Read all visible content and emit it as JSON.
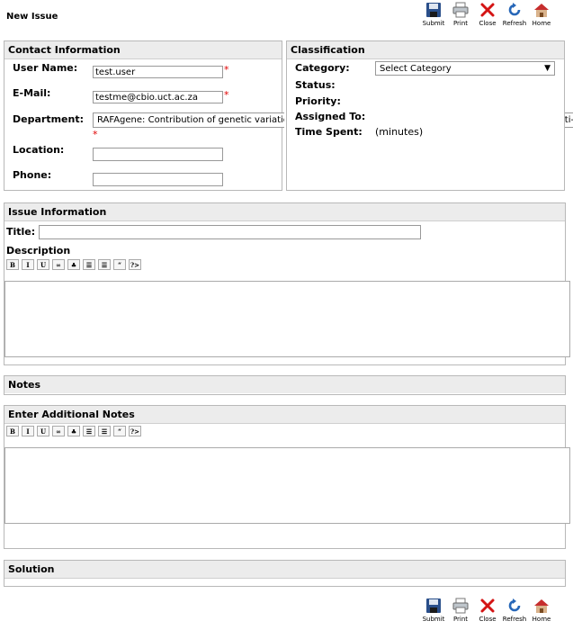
{
  "page": {
    "title": "New Issue"
  },
  "toolbar": {
    "submit": "Submit",
    "print": "Print",
    "close": "Close",
    "refresh": "Refresh",
    "home": "Home"
  },
  "contact": {
    "heading": "Contact Information",
    "user_name_label": "User Name:",
    "user_name_value": "test.user",
    "email_label": "E-Mail:",
    "email_value": "testme@cbio.uct.ac.za",
    "department_label": "Department:",
    "department_value": "RAFAgene: Contribution of genetic variation to",
    "department_overflow": "lti-",
    "location_label": "Location:",
    "location_value": "",
    "phone_label": "Phone:",
    "phone_value": "",
    "required_mark": "*"
  },
  "classification": {
    "heading": "Classification",
    "category_label": "Category:",
    "category_value": "Select Category",
    "status_label": "Status:",
    "priority_label": "Priority:",
    "assigned_label": "Assigned To:",
    "time_label": "Time Spent:",
    "time_unit": "(minutes)"
  },
  "issue": {
    "heading": "Issue Information",
    "title_label": "Title:",
    "title_value": "",
    "description_label": "Description"
  },
  "editor_buttons": [
    "B",
    "I",
    "U",
    "∞",
    "♣",
    "☰",
    "☰",
    "“",
    "?>"
  ],
  "notes": {
    "heading": "Notes"
  },
  "additional_notes": {
    "heading": "Enter Additional Notes"
  },
  "solution": {
    "heading": "Solution"
  }
}
